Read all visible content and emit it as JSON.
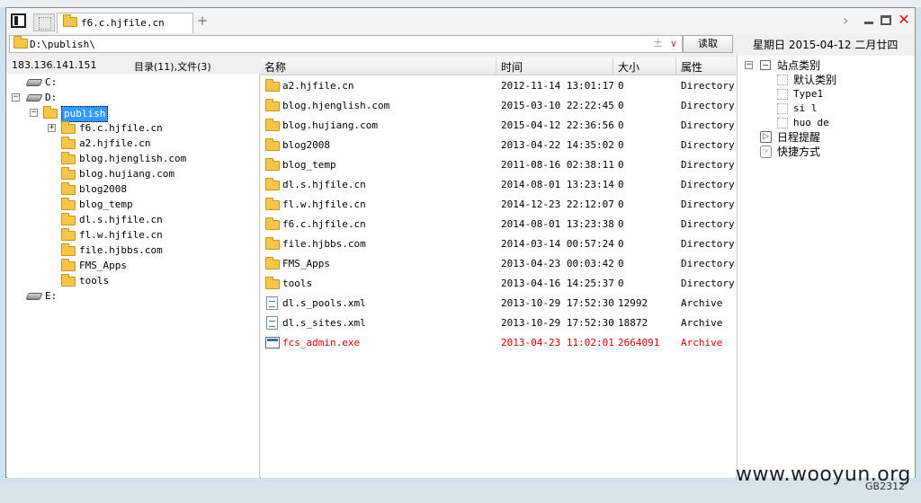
{
  "tabs": [
    {
      "label": "f6.c.hjfile.cn",
      "icon": "folder-icon"
    }
  ],
  "tab_add_label": "+",
  "window_controls": {
    "forward": "›",
    "close": "✕"
  },
  "address": {
    "path": "D:\\publish\\",
    "toggle": "±",
    "dropdown": "∨"
  },
  "read_button_label": "读取",
  "date_text": "星期日 2015-04-12 二月廿四",
  "status": {
    "ip": "183.136.141.151",
    "counts": "目录(11),文件(3)"
  },
  "tree": {
    "drives": [
      {
        "label": "C:"
      },
      {
        "label": "D:",
        "expand": "−"
      },
      {
        "label": "E:"
      }
    ],
    "root": {
      "label": "publish",
      "expand": "−"
    },
    "children": [
      {
        "label": "f6.c.hjfile.cn",
        "expand": "+"
      },
      {
        "label": "a2.hjfile.cn"
      },
      {
        "label": "blog.hjenglish.com"
      },
      {
        "label": "blog.hujiang.com"
      },
      {
        "label": "blog2008"
      },
      {
        "label": "blog_temp"
      },
      {
        "label": "dl.s.hjfile.cn"
      },
      {
        "label": "fl.w.hjfile.cn"
      },
      {
        "label": "file.hjbbs.com"
      },
      {
        "label": "FMS_Apps"
      },
      {
        "label": "tools"
      }
    ]
  },
  "list": {
    "columns": [
      "名称",
      "时间",
      "大小",
      "属性"
    ],
    "rows": [
      {
        "icon": "folder-icon",
        "name": "a2.hjfile.cn",
        "time": "2012-11-14 13:01:17",
        "size": "0",
        "attr": "Directory"
      },
      {
        "icon": "folder-icon",
        "name": "blog.hjenglish.com",
        "time": "2015-03-10 22:22:45",
        "size": "0",
        "attr": "Directory"
      },
      {
        "icon": "folder-icon",
        "name": "blog.hujiang.com",
        "time": "2015-04-12 22:36:56",
        "size": "0",
        "attr": "Directory"
      },
      {
        "icon": "folder-icon",
        "name": "blog2008",
        "time": "2013-04-22 14:35:02",
        "size": "0",
        "attr": "Directory"
      },
      {
        "icon": "folder-icon",
        "name": "blog_temp",
        "time": "2011-08-16 02:38:11",
        "size": "0",
        "attr": "Directory"
      },
      {
        "icon": "folder-icon",
        "name": "dl.s.hjfile.cn",
        "time": "2014-08-01 13:23:14",
        "size": "0",
        "attr": "Directory"
      },
      {
        "icon": "folder-icon",
        "name": "fl.w.hjfile.cn",
        "time": "2014-12-23 22:12:07",
        "size": "0",
        "attr": "Directory"
      },
      {
        "icon": "folder-icon",
        "name": "f6.c.hjfile.cn",
        "time": "2014-08-01 13:23:38",
        "size": "0",
        "attr": "Directory"
      },
      {
        "icon": "folder-icon",
        "name": "file.hjbbs.com",
        "time": "2014-03-14 00:57:24",
        "size": "0",
        "attr": "Directory"
      },
      {
        "icon": "folder-icon",
        "name": "FMS_Apps",
        "time": "2013-04-23 00:03:42",
        "size": "0",
        "attr": "Directory"
      },
      {
        "icon": "folder-icon",
        "name": "tools",
        "time": "2013-04-16 14:25:37",
        "size": "0",
        "attr": "Directory"
      },
      {
        "icon": "xml-file-icon",
        "name": "dl.s_pools.xml",
        "time": "2013-10-29 17:52:30",
        "size": "12992",
        "attr": "Archive"
      },
      {
        "icon": "xml-file-icon",
        "name": "dl.s_sites.xml",
        "time": "2013-10-29 17:52:30",
        "size": "18872",
        "attr": "Archive"
      },
      {
        "icon": "exe-file-icon",
        "name": "fcs_admin.exe",
        "time": "2013-04-23 11:02:01",
        "size": "2664091",
        "attr": "Archive",
        "highlight": true
      }
    ]
  },
  "right_panel": {
    "category_root": {
      "label": "站点类别",
      "expand": "−"
    },
    "categories": [
      "默认类别",
      "Type1",
      "si l",
      "huo de"
    ],
    "schedule": "日程提醒",
    "shortcut": "快捷方式"
  },
  "encoding": "GB2312",
  "watermark": "www.wooyun.org",
  "colors": {
    "highlight_row": "#e00000",
    "selection": "#3399ff",
    "folder": "#f6c64b"
  }
}
